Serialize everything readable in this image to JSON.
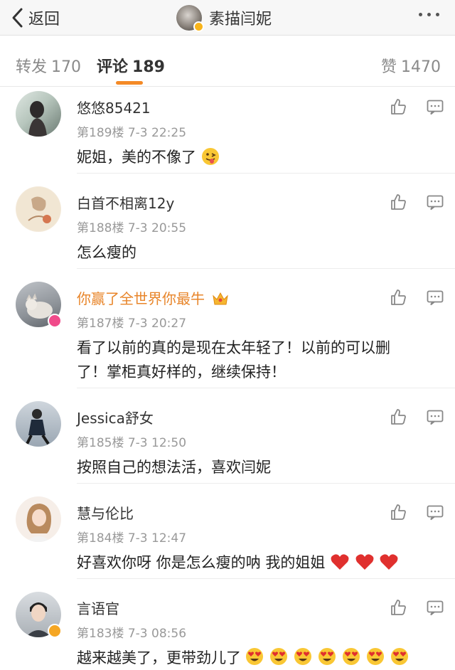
{
  "nav": {
    "back_label": "返回",
    "title": "素描闫妮"
  },
  "tabs": [
    {
      "label": "转发",
      "count": "170"
    },
    {
      "label": "评论",
      "count": "189"
    },
    {
      "label": "赞",
      "count": "1470"
    }
  ],
  "colors": {
    "accent": "#f48a26",
    "vip_name": "#e8852a",
    "meta": "#999999"
  },
  "comments": [
    {
      "name": "悠悠85421",
      "meta": "第189楼 7-3 22:25",
      "text": "妮姐，美的不像了",
      "emoji": "tongue-face-icon"
    },
    {
      "name": "白首不相离12y",
      "meta": "第188楼 7-3 20:55",
      "text": "怎么瘦的"
    },
    {
      "name": "你赢了全世界你最牛",
      "meta": "第187楼 7-3 20:27",
      "text_line1": "看了以前的真的是现在太年轻了！以前的可以删",
      "text_line2": "了！掌柜真好样的，继续保持！",
      "badge": "vip-crown-icon"
    },
    {
      "name": "Jessica舒女",
      "meta": "第185楼 7-3 12:50",
      "text": "按照自己的想法活，喜欢闫妮"
    },
    {
      "name": "慧与伦比",
      "meta": "第184楼 7-3 12:47",
      "text": "好喜欢你呀 你是怎么瘦的呐 我的姐姐",
      "emoji": "red-heart-icon"
    },
    {
      "name": "言语官",
      "meta": "第183楼 7-3 08:56",
      "text": "越来越美了，更带劲儿了",
      "emoji": "heart-eyes-icon"
    }
  ]
}
